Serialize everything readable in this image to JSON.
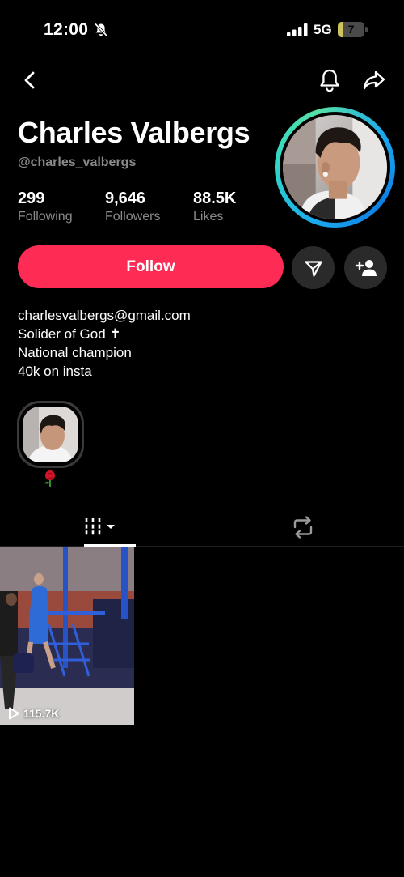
{
  "status_bar": {
    "time": "12:00",
    "network": "5G",
    "battery_level": "7",
    "battery_fraction": 0.07,
    "icons": [
      "bell-slash-icon",
      "signal-icon",
      "battery-icon"
    ]
  },
  "nav": {
    "icons": [
      "chevron-left-icon",
      "bell-icon",
      "share-arrow-icon"
    ]
  },
  "profile": {
    "display_name": "Charles Valbergs",
    "username": "@charles_valbergs",
    "stats": [
      {
        "value": "299",
        "label": "Following"
      },
      {
        "value": "9,646",
        "label": "Followers"
      },
      {
        "value": "88.5K",
        "label": "Likes"
      }
    ],
    "avatar_ring_colors": [
      "#1aa9f0",
      "#2ed8c8"
    ]
  },
  "actions": {
    "follow_label": "Follow",
    "follow_color": "#fe2c55",
    "message_icon": "paper-plane-icon",
    "add_friend_icon": "add-user-icon"
  },
  "bio": {
    "lines": [
      "charlesvalbergs@gmail.com",
      "Solider of God ✝",
      "National champion",
      "40k on insta"
    ]
  },
  "highlight": {
    "emoji": "🌹"
  },
  "tabs": {
    "items": [
      {
        "name": "videos",
        "icon": "grid-bars-icon",
        "active": true
      },
      {
        "name": "reposts",
        "icon": "repost-icon",
        "active": false
      }
    ]
  },
  "videos": [
    {
      "views": "115.7K"
    }
  ]
}
